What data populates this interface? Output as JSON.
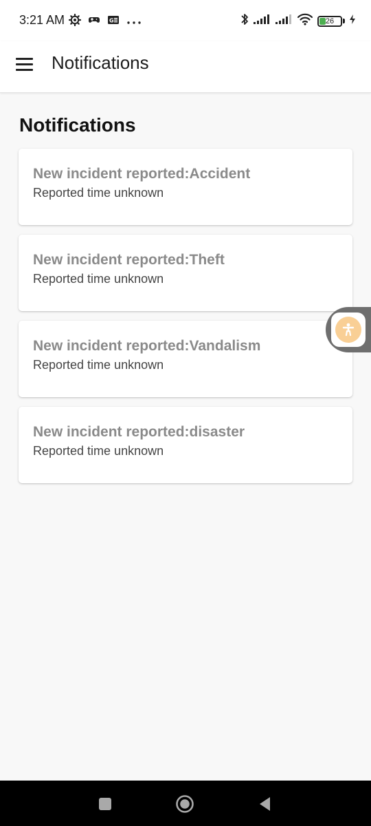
{
  "status_bar": {
    "time": "3:21 AM",
    "battery_level": "26",
    "left_icons": [
      "settings-gear-icon",
      "game-controller-icon",
      "sim-card-icon",
      "more-dots-icon"
    ],
    "right_icons": [
      "bluetooth-icon",
      "signal-icon",
      "signal-icon",
      "wifi-icon",
      "battery-icon",
      "charging-icon"
    ]
  },
  "app_bar": {
    "title": "Notifications",
    "menu_icon": "hamburger-menu-icon"
  },
  "page": {
    "heading": "Notifications"
  },
  "notifications": [
    {
      "title": "New incident reported:Accident",
      "time": "Reported time unknown"
    },
    {
      "title": "New incident reported:Theft",
      "time": "Reported time unknown"
    },
    {
      "title": "New incident reported:Vandalism",
      "time": "Reported time unknown"
    },
    {
      "title": "New incident reported:disaster",
      "time": "Reported time unknown"
    }
  ],
  "floating_button": {
    "icon": "accessibility-icon",
    "color": "#f9cf95"
  },
  "nav_bar": {
    "buttons": [
      "recents-square-icon",
      "home-circle-icon",
      "back-triangle-icon"
    ]
  },
  "colors": {
    "background": "#f8f8f8",
    "card": "#ffffff",
    "title_text": "#8a8a8a",
    "battery_fill": "#4caf50"
  }
}
